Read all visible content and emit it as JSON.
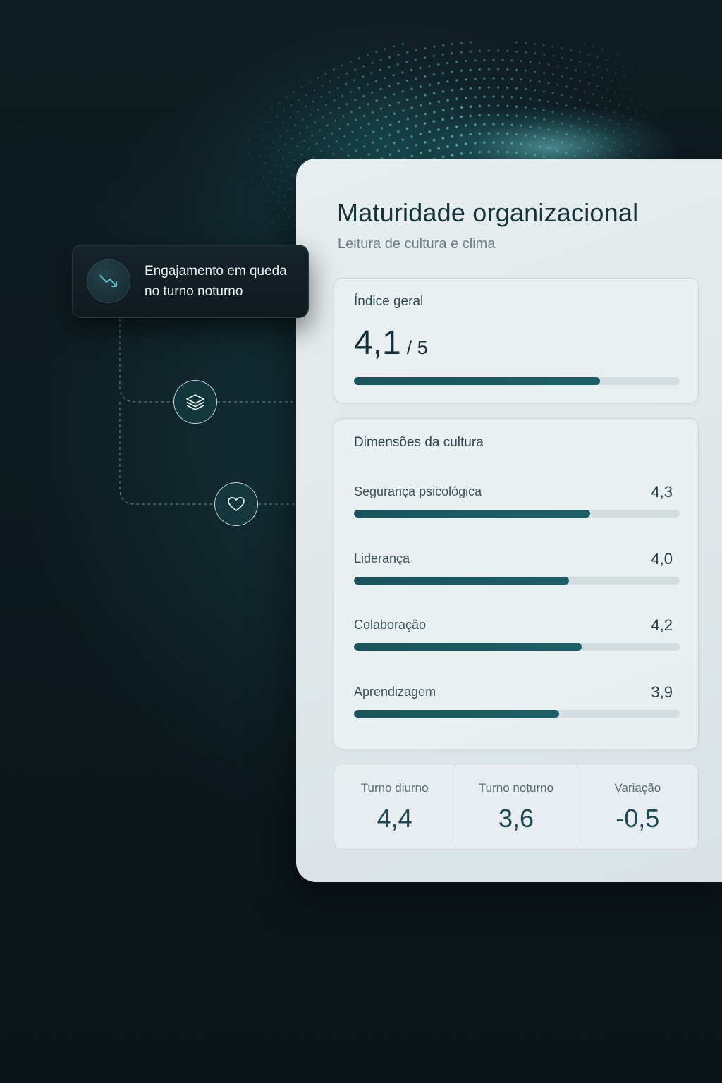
{
  "alert": {
    "icon": "trend-down-icon",
    "line1": "Engajamento em queda",
    "line2": "no turno noturno"
  },
  "nodes": {
    "first_icon": "layers-icon",
    "second_icon": "heart-icon"
  },
  "panel": {
    "title": "Maturidade organizacional",
    "subtitle": "Leitura de cultura e clima"
  },
  "index": {
    "label": "Índice geral",
    "value": "4,1",
    "max": "/ 5",
    "fill_fraction": 0.755
  },
  "dimensions": {
    "title": "Dimensões da cultura",
    "items": [
      {
        "label": "Segurança psicológica",
        "value": "4,3",
        "fill_fraction": 0.725
      },
      {
        "label": "Liderança",
        "value": "4,0",
        "fill_fraction": 0.66
      },
      {
        "label": "Colaboração",
        "value": "4,2",
        "fill_fraction": 0.7
      },
      {
        "label": "Aprendizagem",
        "value": "3,9",
        "fill_fraction": 0.63
      }
    ]
  },
  "stats": [
    {
      "label": "Turno diurno",
      "value": "4,4"
    },
    {
      "label": "Turno noturno",
      "value": "3,6"
    },
    {
      "label": "Variação",
      "value": "-0,5"
    }
  ],
  "colors": {
    "accent": "#1a545b",
    "background": "#0f1c21",
    "panel": "#e3eaec"
  }
}
